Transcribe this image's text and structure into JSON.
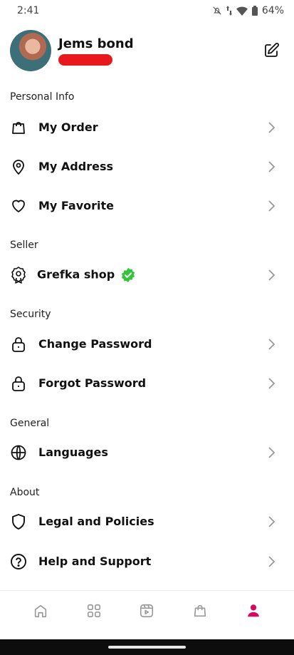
{
  "status_bar": {
    "time": "2:41",
    "battery": "64%"
  },
  "profile": {
    "name": "Jems bond"
  },
  "sections": {
    "personal_info": "Personal Info",
    "seller": "Seller",
    "security": "Security",
    "general": "General",
    "about": "About"
  },
  "menu": {
    "my_order": "My Order",
    "my_address": "My Address",
    "my_favorite": "My Favorite",
    "shop": "Grefka shop",
    "change_password": "Change Password",
    "forgot_password": "Forgot Password",
    "languages": "Languages",
    "legal": "Legal and Policies",
    "help": "Help and Support"
  },
  "colors": {
    "accent": "#d9075f",
    "verified": "#35c33c",
    "redaction": "#e8191d"
  },
  "nav": {
    "active": "profile"
  }
}
